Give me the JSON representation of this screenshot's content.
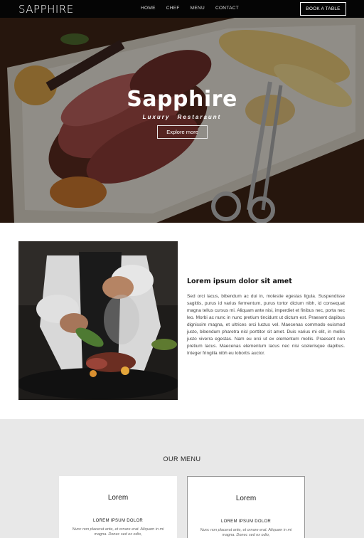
{
  "nav": {
    "logo": "SAPPHIRE",
    "items": [
      {
        "label": "HOME"
      },
      {
        "label": "CHEF"
      },
      {
        "label": "MENU"
      },
      {
        "label": "CONTACT"
      }
    ],
    "cta": "BOOK A TABLE"
  },
  "hero": {
    "title": "Sapphire",
    "subtitle": "Luxury Restaraunt",
    "button": "Explore more",
    "image_icon": "steak-platter-image"
  },
  "about": {
    "title": "Lorem ipsum dolor sit amet",
    "body": "Sed orci lacus, bibendum ac dui in, molestie egestas ligula. Suspendisse sagittis, purus id varius fermentum, purus tortor dictum nibh, id consequat magna tellus cursus mi. Aliquam ante nisi, imperdiet et finibus nec, porta nec leo. Morbi ac nunc in nunc pretium tincidunt ut dictum est. Praesent dapibus dignissim magna, et ultrices orci luctus vel. Maecenas commodo euismod justo, bibendum pharetra nisl porttitor sit amet. Duis varius mi elit, in mollis justo viverra egestas. Nam eu orci ut ex elementum mollis. Praesent non pretium lacus. Maecenas elementum lacus nec nisi scelerisque dapibus. Integer fringilla nibh eu lobortis auctor.",
    "image_icon": "chef-plating-image"
  },
  "menu_section": {
    "heading": "OUR MENU",
    "cards": [
      {
        "title": "Lorem",
        "subtitle": "LOREM IPSUM DOLOR",
        "desc": "Nunc non placerat ante, et ornare erat. Aliquam in mi magna. Donec sed ex odio,"
      },
      {
        "title": "Lorem",
        "subtitle": "LOREM IPSUM DOLOR",
        "desc": "Nunc non placerat ante, et ornare erat. Aliquam in mi magna. Donec sed ex odio,"
      }
    ]
  },
  "colors": {
    "nav_bg": "#050505",
    "section_bg": "#e8e8e8",
    "hero_bg": "#3a2518"
  }
}
